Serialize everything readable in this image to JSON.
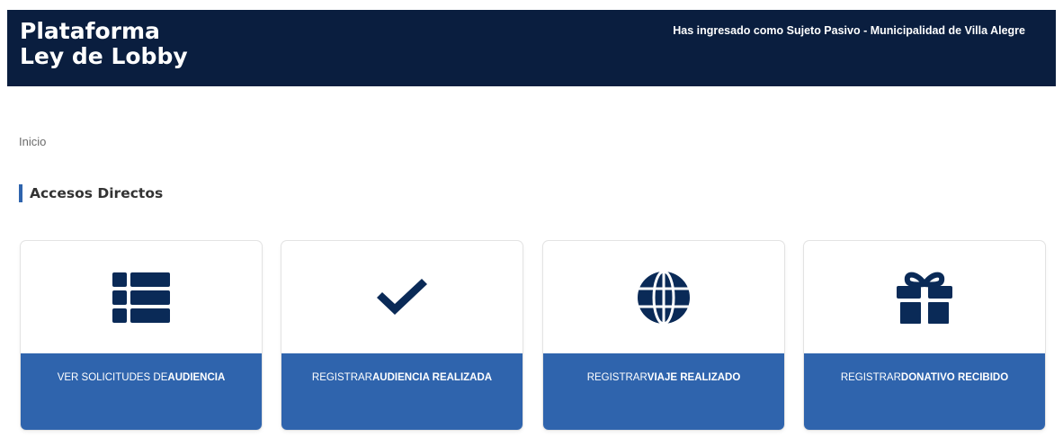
{
  "header": {
    "brand_line1": "Plataforma",
    "brand_line2": "Ley de Lobby",
    "session_text": "Has ingresado como Sujeto Pasivo - Municipalidad de Villa Alegre"
  },
  "breadcrumb": "Inicio",
  "section_title": "Accesos Directos",
  "cards": [
    {
      "icon": "list-icon",
      "label_normal": "VER SOLICITUDES DE ",
      "label_bold": "AUDIENCIA"
    },
    {
      "icon": "check-icon",
      "label_normal": "REGISTRAR ",
      "label_bold": "AUDIENCIA REALIZADA"
    },
    {
      "icon": "globe-icon",
      "label_normal": "REGISTRAR ",
      "label_bold": "VIAJE REALIZADO"
    },
    {
      "icon": "gift-icon",
      "label_normal": "REGISTRAR ",
      "label_bold": "DONATIVO RECIBIDO"
    }
  ],
  "colors": {
    "header_bg": "#0a1e3f",
    "accent": "#2f64ad",
    "icon": "#0a2a57"
  }
}
